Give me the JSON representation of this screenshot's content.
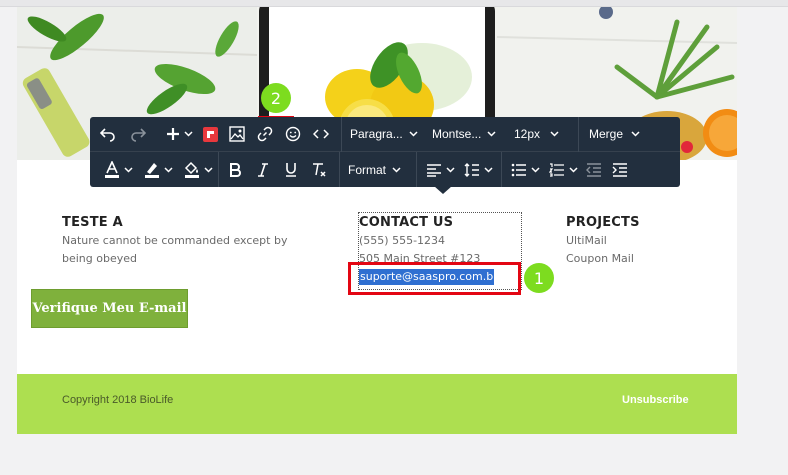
{
  "toolbar": {
    "row1": {
      "undo": "undo-icon",
      "redo": "redo-icon",
      "insert": "plus-icon",
      "paragraph_label": "Paragra...",
      "font_label": "Montse...",
      "size_label": "12px",
      "merge_label": "Merge"
    },
    "row2": {
      "format_label": "Format"
    }
  },
  "email": {
    "col1": {
      "title": "TESTE A",
      "text": "Nature cannot be commanded except by being obeyed"
    },
    "col2": {
      "title": "CONTACT US",
      "phone": "(555) 555-1234",
      "address": "505 Main Street #123",
      "email": "suporte@saaspro.com.br"
    },
    "col3": {
      "title": "PROJECTS",
      "item1": "UltiMail",
      "item2": "Coupon Mail"
    },
    "verify_button": "Verifique Meu E-mail",
    "footer": {
      "copyright": "Copyright 2018 BioLife",
      "unsubscribe": "Unsubscribe"
    }
  },
  "annotations": {
    "badge1": "1",
    "badge2": "2"
  },
  "colors": {
    "toolbar_bg": "#222f3e",
    "footer_green": "#addf50",
    "button_green": "#7fb13c",
    "highlight": "#e30613",
    "badge": "#7ddc1f",
    "selection": "#2f6fd1"
  }
}
